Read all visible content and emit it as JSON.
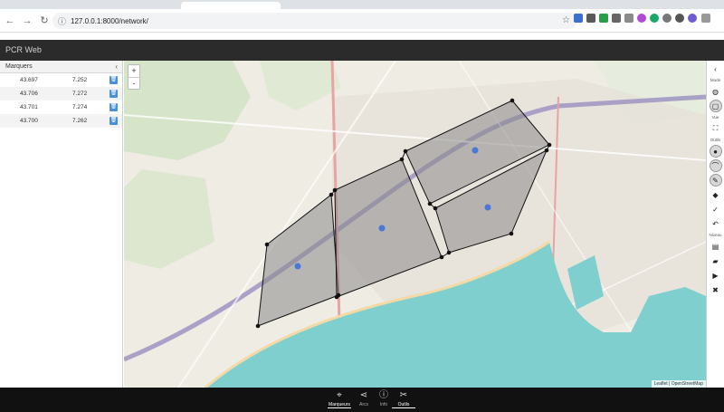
{
  "browser": {
    "url": "127.0.0.1:8000/network/"
  },
  "app": {
    "title": "PCR Web"
  },
  "sidebar": {
    "title": "Marquers",
    "rows": [
      {
        "lat": "43.697",
        "lng": "7.252"
      },
      {
        "lat": "43.706",
        "lng": "7.272"
      },
      {
        "lat": "43.701",
        "lng": "7.274"
      },
      {
        "lat": "43.700",
        "lng": "7.262"
      }
    ]
  },
  "map": {
    "zoom_in": "+",
    "zoom_out": "-",
    "attribution": "Leaflet | OpenStreetMap",
    "sea_color": "#7fcfcf",
    "polygon_fill": "#8a8a8a",
    "vertex_color": "#111111",
    "centroid_color": "#4a78d6"
  },
  "tools": {
    "mode_label": "Mode",
    "vue_label": "Vue",
    "outils_label": "Outils",
    "niveau_label": "Niveau"
  },
  "bottom_nav": [
    {
      "label": "Marqueurs",
      "icon": "marker-icon"
    },
    {
      "label": "Arcs",
      "icon": "share-icon"
    },
    {
      "label": "Info",
      "icon": "info-icon"
    },
    {
      "label": "Outils",
      "icon": "tools-icon"
    }
  ]
}
